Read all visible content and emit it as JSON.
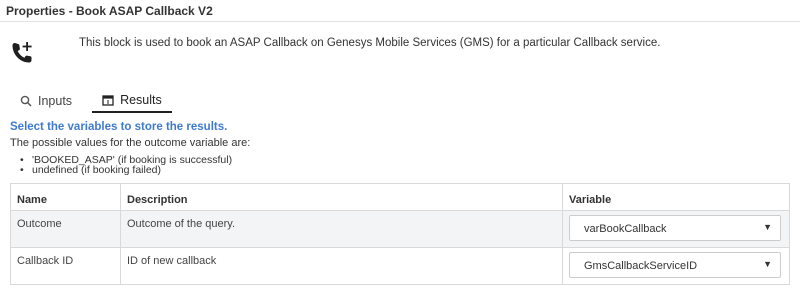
{
  "window": {
    "title": "Properties - Book ASAP Callback V2"
  },
  "block": {
    "icon": "phone-add-icon",
    "description": "This block is used to book an ASAP Callback on Genesys Mobile Services (GMS) for a particular Callback service."
  },
  "tabs": [
    {
      "label": "Inputs",
      "icon": "search-icon",
      "active": false
    },
    {
      "label": "Results",
      "icon": "calendar-icon",
      "active": true
    }
  ],
  "results": {
    "hint": "Select the variables to store the results.",
    "possible_values_intro": "The possible values for the outcome variable are:",
    "possible_values": [
      "'BOOKED_ASAP' (if booking is successful)",
      "undefined (if booking failed)"
    ],
    "table": {
      "headers": {
        "name": "Name",
        "description": "Description",
        "variable": "Variable"
      },
      "rows": [
        {
          "name": "Outcome",
          "description": "Outcome of the query.",
          "variable": "varBookCallback"
        },
        {
          "name": "Callback ID",
          "description": "ID of new callback",
          "variable": "GmsCallbackServiceID"
        }
      ]
    }
  },
  "colors": {
    "accent": "#3f7ad1",
    "row_highlight": "#f3f4f6",
    "border": "#d9d9d9"
  },
  "glyphs": {
    "dropdown_arrow": "▼"
  }
}
